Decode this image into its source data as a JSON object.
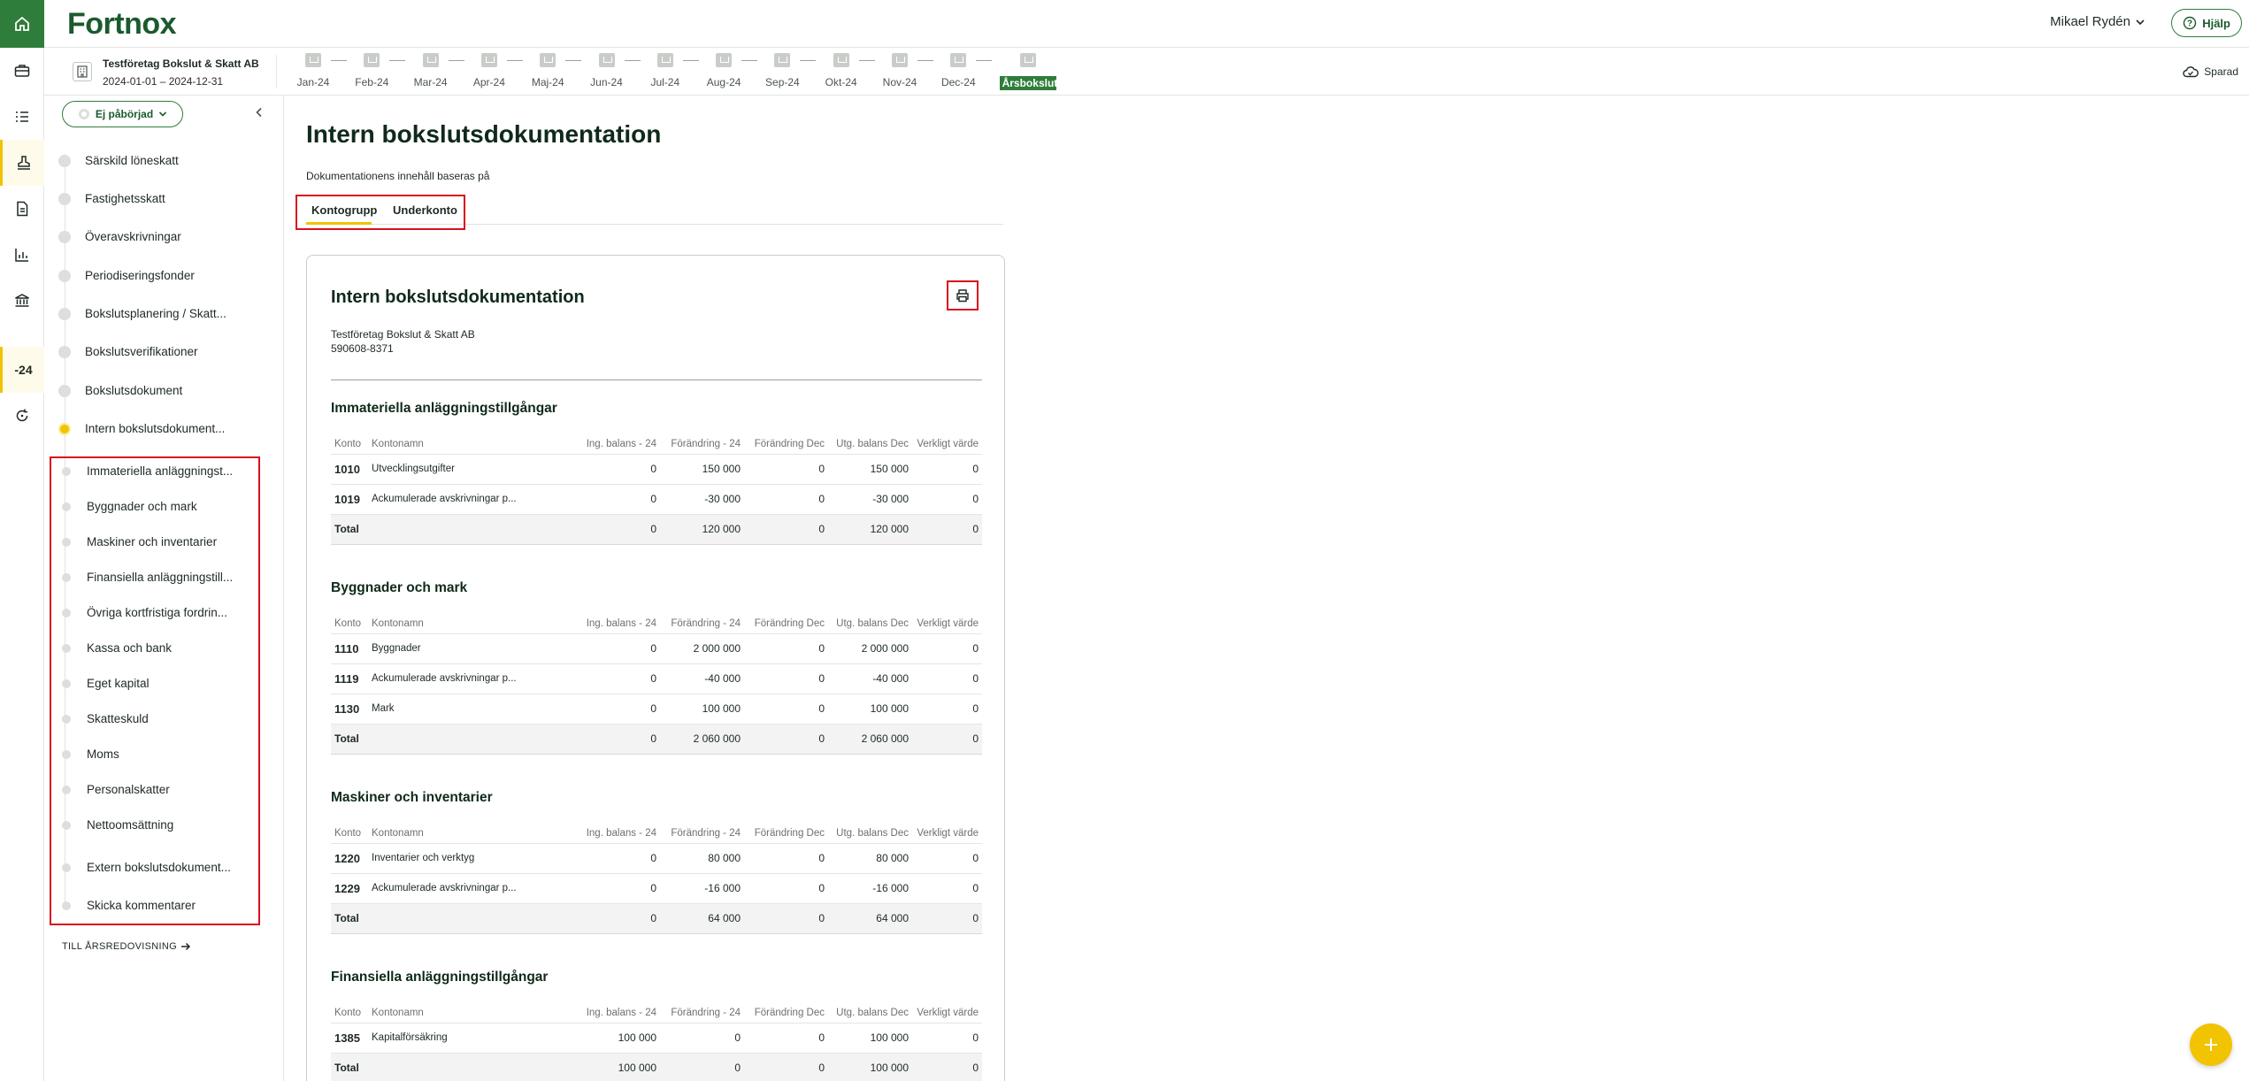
{
  "brand": {
    "logo": "Fortnox",
    "accent": "#2f7d3a",
    "highlight": "#f2c300"
  },
  "header": {
    "user_name": "Mikael Rydén",
    "help_label": "Hjälp"
  },
  "rail": {
    "items": [
      "home-icon",
      "briefcase-icon",
      "checklist-icon",
      "stamp-icon",
      "document-icon",
      "bar-chart-icon",
      "bank-icon"
    ],
    "year_label": "-24"
  },
  "company": {
    "name": "Testföretag Bokslut & Skatt AB",
    "period": "2024-01-01 – 2024-12-31"
  },
  "months": [
    "Jan-24",
    "Feb-24",
    "Mar-24",
    "Apr-24",
    "Maj-24",
    "Jun-24",
    "Jul-24",
    "Aug-24",
    "Sep-24",
    "Okt-24",
    "Nov-24",
    "Dec-24",
    "Årsbokslut"
  ],
  "saved_label": "Sparad",
  "status": {
    "label": "Ej påbörjad"
  },
  "steps": [
    "Särskild löneskatt",
    "Fastighetsskatt",
    "Överavskrivningar",
    "Periodiseringsfonder",
    "Bokslutsplanering / Skatt...",
    "Bokslutsverifikationer",
    "Bokslutsdokument",
    "Intern bokslutsdokument..."
  ],
  "substeps": [
    "Immateriella anläggningst...",
    "Byggnader och mark",
    "Maskiner och inventarier",
    "Finansiella anläggningstill...",
    "Övriga kortfristiga fordrin...",
    "Kassa och bank",
    "Eget kapital",
    "Skatteskuld",
    "Moms",
    "Personalskatter",
    "Nettoomsättning",
    "Extern bokslutsdokument...",
    "Skicka kommentarer"
  ],
  "to_annual": "TILL ÅRSREDOVISNING",
  "main": {
    "title": "Intern bokslutsdokumentation",
    "basis_label": "Dokumentationens innehåll baseras på",
    "tabs": [
      "Kontogrupp",
      "Underkonto"
    ]
  },
  "card": {
    "title": "Intern bokslutsdokumentation",
    "company": "Testföretag Bokslut & Skatt AB",
    "org_nr": "590608-8371"
  },
  "columns": [
    "Konto",
    "Kontonamn",
    "Ing. balans - 24",
    "Förändring - 24",
    "Förändring Dec",
    "Utg. balans Dec",
    "Verkligt värde"
  ],
  "sections": [
    {
      "title": "Immateriella anläggningstillgångar",
      "rows": [
        {
          "account": "1010",
          "name": "Utvecklingsutgifter",
          "values": [
            "0",
            "150 000",
            "0",
            "150 000",
            "0"
          ]
        },
        {
          "account": "1019",
          "name": "Ackumulerade avskrivningar p...",
          "values": [
            "0",
            "-30 000",
            "0",
            "-30 000",
            "0"
          ]
        }
      ],
      "total": {
        "label": "Total",
        "values": [
          "0",
          "120 000",
          "0",
          "120 000",
          "0"
        ]
      }
    },
    {
      "title": "Byggnader och mark",
      "rows": [
        {
          "account": "1110",
          "name": "Byggnader",
          "values": [
            "0",
            "2 000 000",
            "0",
            "2 000 000",
            "0"
          ]
        },
        {
          "account": "1119",
          "name": "Ackumulerade avskrivningar p...",
          "values": [
            "0",
            "-40 000",
            "0",
            "-40 000",
            "0"
          ]
        },
        {
          "account": "1130",
          "name": "Mark",
          "values": [
            "0",
            "100 000",
            "0",
            "100 000",
            "0"
          ]
        }
      ],
      "total": {
        "label": "Total",
        "values": [
          "0",
          "2 060 000",
          "0",
          "2 060 000",
          "0"
        ]
      }
    },
    {
      "title": "Maskiner och inventarier",
      "rows": [
        {
          "account": "1220",
          "name": "Inventarier och verktyg",
          "values": [
            "0",
            "80 000",
            "0",
            "80 000",
            "0"
          ]
        },
        {
          "account": "1229",
          "name": "Ackumulerade avskrivningar p...",
          "values": [
            "0",
            "-16 000",
            "0",
            "-16 000",
            "0"
          ]
        }
      ],
      "total": {
        "label": "Total",
        "values": [
          "0",
          "64 000",
          "0",
          "64 000",
          "0"
        ]
      }
    },
    {
      "title": "Finansiella anläggningstillgångar",
      "rows": [
        {
          "account": "1385",
          "name": "Kapitalförsäkring",
          "values": [
            "100 000",
            "0",
            "0",
            "100 000",
            "0"
          ]
        }
      ],
      "total": {
        "label": "Total",
        "values": [
          "100 000",
          "0",
          "0",
          "100 000",
          "0"
        ]
      }
    }
  ]
}
